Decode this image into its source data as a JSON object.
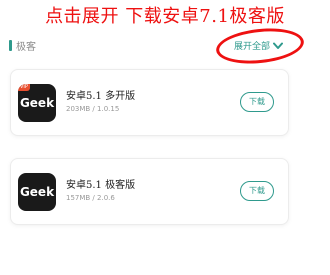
{
  "annotation": {
    "text": "点击展开  下载安卓7.1极客版",
    "color": "#ee1111"
  },
  "section": {
    "title": "极客",
    "expand_label": "展开全部",
    "accent": "#2f9a8d"
  },
  "apps": [
    {
      "name": "安卓5.1 多开版",
      "meta": "203MB / 1.0.15",
      "icon_text": "Geek",
      "badge": "VIP",
      "download_label": "下载"
    },
    {
      "name": "安卓5.1 极客版",
      "meta": "157MB / 2.0.6",
      "icon_text": "Geek",
      "download_label": "下载"
    }
  ],
  "icons": {
    "expand": "chevron-down-icon",
    "app": "geek-app-icon"
  }
}
